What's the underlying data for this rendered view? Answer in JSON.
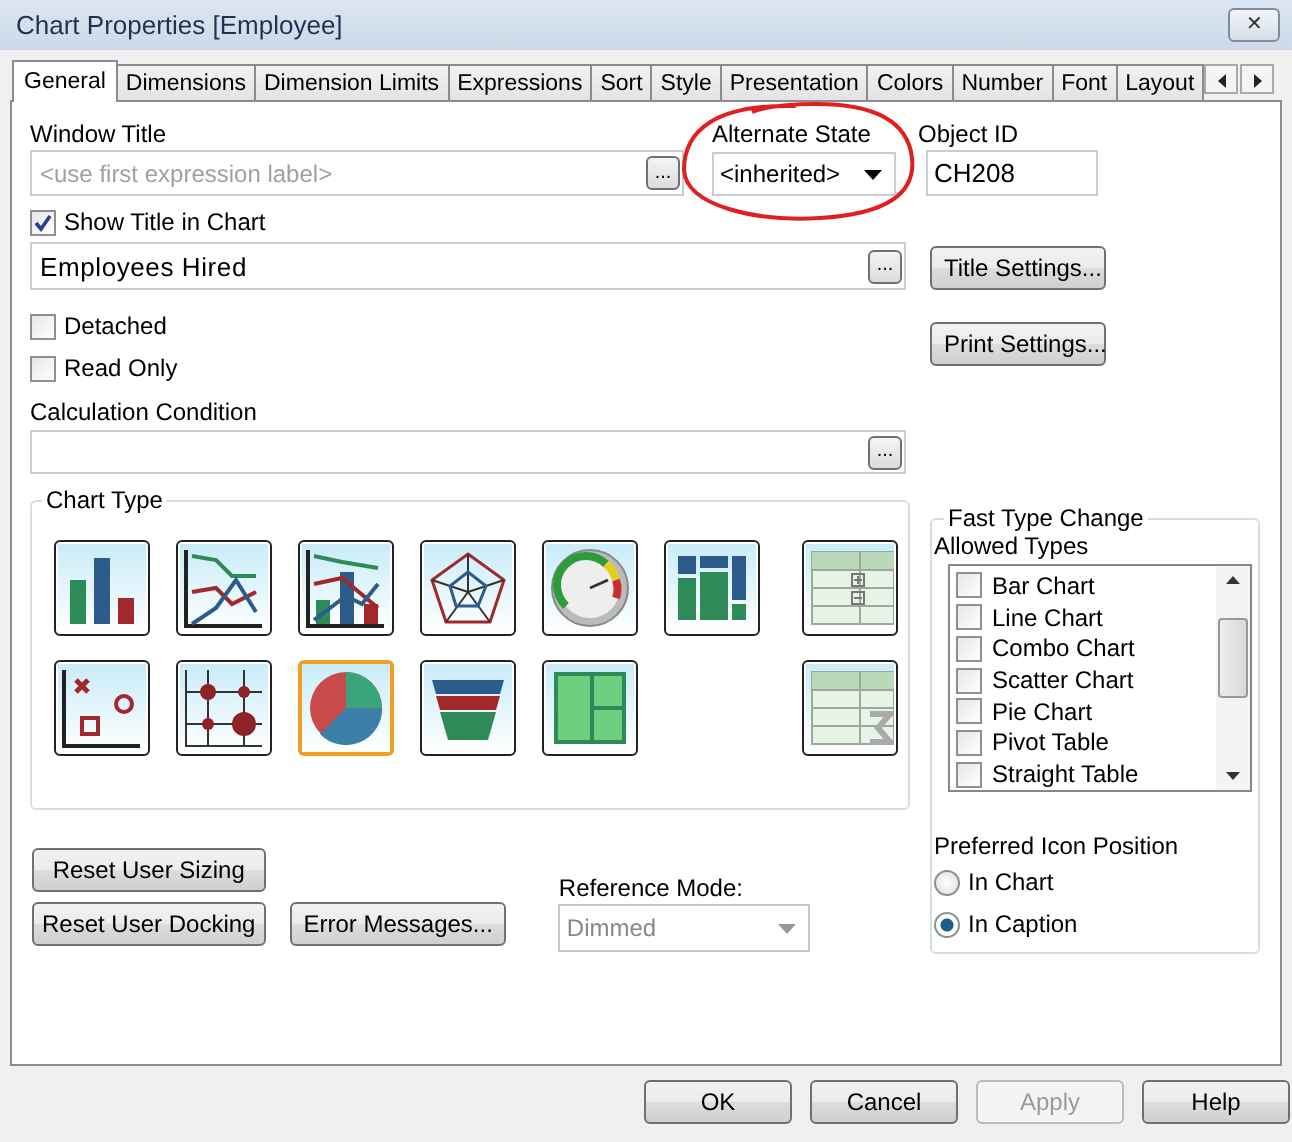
{
  "window": {
    "title": "Chart Properties [Employee]",
    "close": "✕"
  },
  "tabs": [
    {
      "label": "General",
      "selected": true
    },
    {
      "label": "Dimensions",
      "selected": false
    },
    {
      "label": "Dimension Limits",
      "selected": false
    },
    {
      "label": "Expressions",
      "selected": false
    },
    {
      "label": "Sort",
      "selected": false
    },
    {
      "label": "Style",
      "selected": false
    },
    {
      "label": "Presentation",
      "selected": false
    },
    {
      "label": "Colors",
      "selected": false
    },
    {
      "label": "Number",
      "selected": false
    },
    {
      "label": "Font",
      "selected": false
    },
    {
      "label": "Layout",
      "selected": false
    }
  ],
  "window_title": {
    "label": "Window Title",
    "placeholder": "<use first expression label>",
    "button": "..."
  },
  "alternate_state": {
    "label": "Alternate State",
    "value": "<inherited>"
  },
  "object_id": {
    "label": "Object ID",
    "value": "CH208"
  },
  "show_title": {
    "label": "Show Title in Chart",
    "checked": true
  },
  "title_field": {
    "value": "Employees Hired",
    "button": "..."
  },
  "title_settings": "Title Settings...",
  "print_settings": "Print Settings...",
  "options": [
    {
      "label": "Detached",
      "checked": false
    },
    {
      "label": "Read Only",
      "checked": false
    }
  ],
  "calculation_condition": {
    "label": "Calculation Condition",
    "button": "..."
  },
  "chart_type": {
    "title": "Chart Type",
    "types": [
      {
        "kind": "bar",
        "selected": false
      },
      {
        "kind": "line",
        "selected": false
      },
      {
        "kind": "combo",
        "selected": false
      },
      {
        "kind": "radar",
        "selected": false
      },
      {
        "kind": "gauge",
        "selected": false
      },
      {
        "kind": "mekko",
        "selected": false
      },
      {
        "kind": "pivot",
        "selected": false
      },
      {
        "kind": "scatter",
        "selected": false
      },
      {
        "kind": "grid",
        "selected": false
      },
      {
        "kind": "pie",
        "selected": true
      },
      {
        "kind": "funnel",
        "selected": false
      },
      {
        "kind": "block",
        "selected": false
      },
      {
        "kind": "straight",
        "selected": false
      }
    ]
  },
  "fast_type_change": {
    "title": "Fast Type Change",
    "allowed_label": "Allowed Types",
    "allowed_types": [
      {
        "label": "Bar Chart",
        "checked": false
      },
      {
        "label": "Line Chart",
        "checked": false
      },
      {
        "label": "Combo Chart",
        "checked": false
      },
      {
        "label": "Scatter Chart",
        "checked": false
      },
      {
        "label": "Pie Chart",
        "checked": false
      },
      {
        "label": "Pivot Table",
        "checked": false
      },
      {
        "label": "Straight Table",
        "checked": false
      }
    ],
    "position_label": "Preferred Icon Position",
    "positions": [
      {
        "label": "In Chart",
        "selected": false
      },
      {
        "label": "In Caption",
        "selected": true
      }
    ]
  },
  "reset_sizing": "Reset User Sizing",
  "reset_docking": "Reset User Docking",
  "error_messages": "Error Messages...",
  "reference_mode": {
    "label": "Reference Mode:",
    "value": "Dimmed",
    "disabled": true
  },
  "buttons": [
    {
      "label": "OK",
      "disabled": false
    },
    {
      "label": "Cancel",
      "disabled": false
    },
    {
      "label": "Apply",
      "disabled": true
    },
    {
      "label": "Help",
      "disabled": false
    }
  ]
}
